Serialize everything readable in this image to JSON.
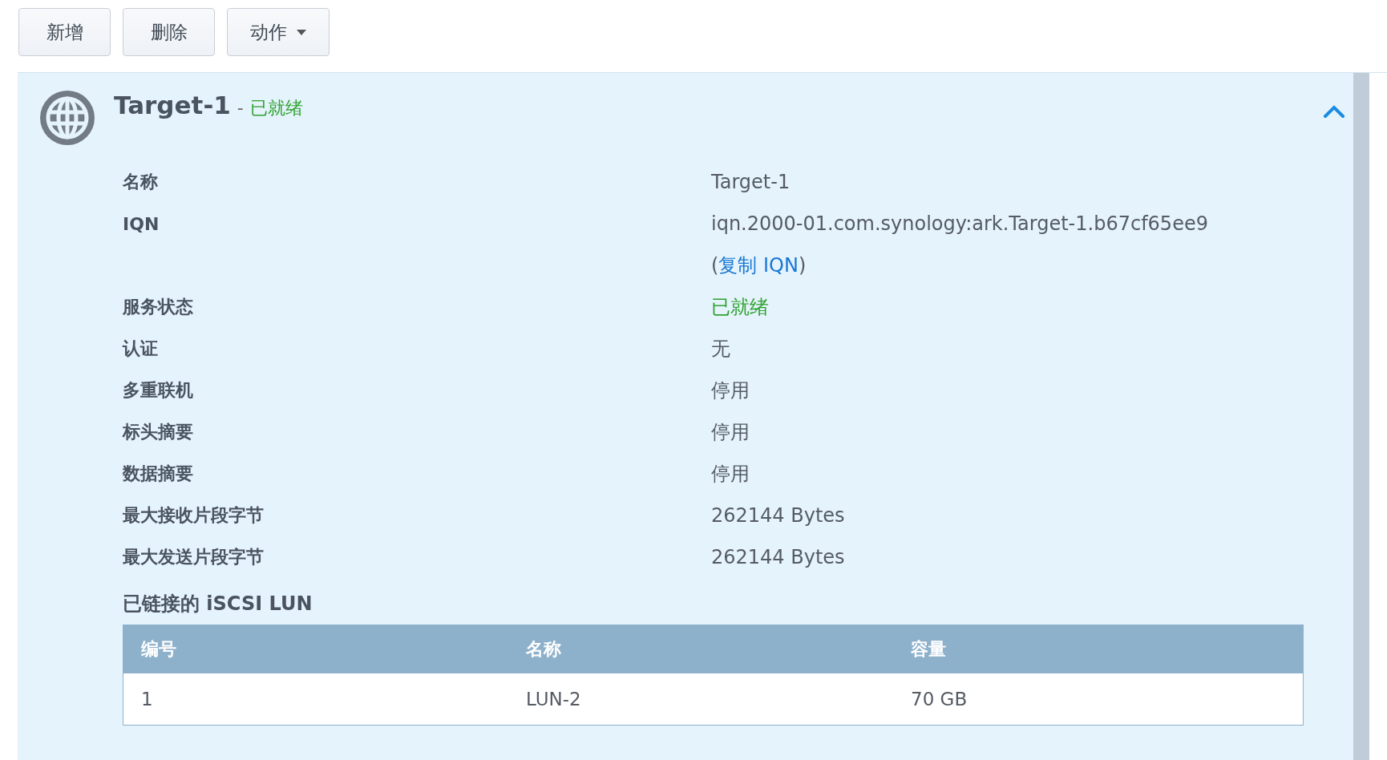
{
  "toolbar": {
    "buttons": [
      {
        "label": "新增",
        "kind": "plain"
      },
      {
        "label": "删除",
        "kind": "plain"
      },
      {
        "label": "动作",
        "kind": "dropdown"
      }
    ]
  },
  "target": {
    "name": "Target-1",
    "separator": "-",
    "status": "已就绪",
    "expanded": true,
    "details": [
      {
        "label": "名称",
        "value": "Target-1",
        "kind": "text"
      },
      {
        "label": "IQN",
        "value": "iqn.2000-01.com.synology:ark.Target-1.b67cf65ee9",
        "kind": "text",
        "copy_link": {
          "prefix": "(",
          "label": "复制 IQN",
          "suffix": ")"
        }
      },
      {
        "label": "服务状态",
        "value": "已就绪",
        "kind": "status"
      },
      {
        "label": "认证",
        "value": "无",
        "kind": "text"
      },
      {
        "label": "多重联机",
        "value": "停用",
        "kind": "text"
      },
      {
        "label": "标头摘要",
        "value": "停用",
        "kind": "text"
      },
      {
        "label": "数据摘要",
        "value": "停用",
        "kind": "text"
      },
      {
        "label": "最大接收片段字节",
        "value": "262144 Bytes",
        "kind": "text"
      },
      {
        "label": "最大发送片段字节",
        "value": "262144 Bytes",
        "kind": "text"
      }
    ],
    "lun_section": {
      "title": "已链接的 iSCSI LUN",
      "table": {
        "columns": [
          "编号",
          "名称",
          "容量"
        ],
        "rows": [
          [
            "1",
            "LUN-2",
            "70 GB"
          ]
        ]
      }
    }
  }
}
